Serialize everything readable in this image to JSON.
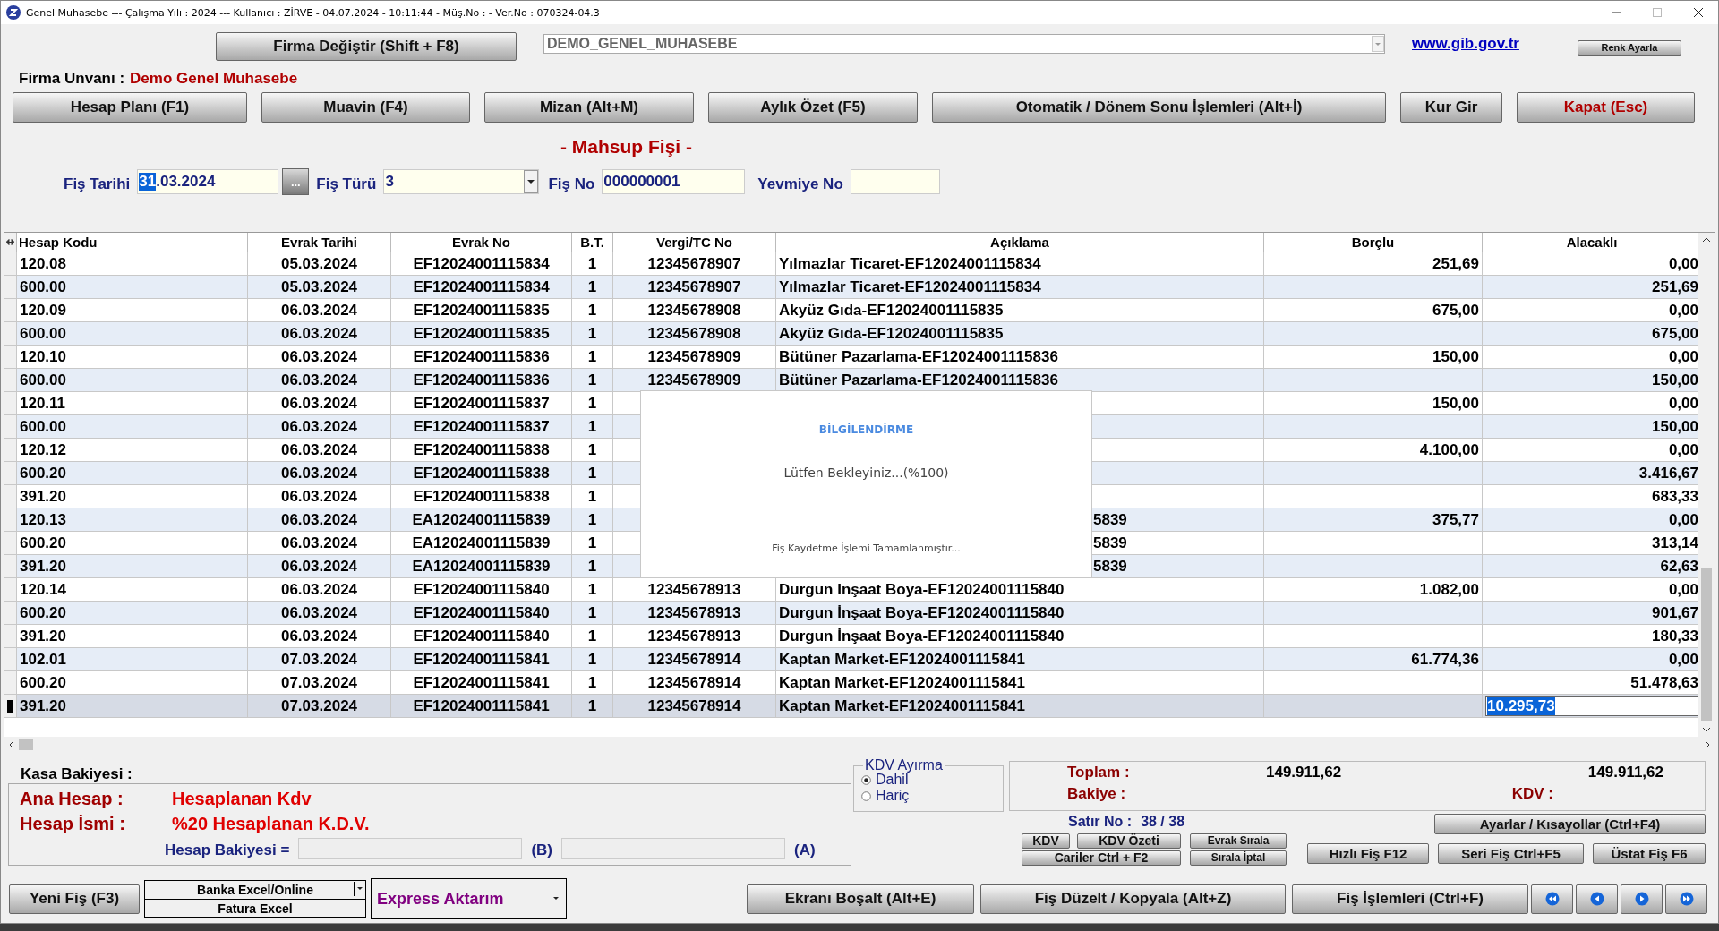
{
  "window": {
    "title": "Genel Muhasebe --- Çalışma Yılı : 2024 --- Kullanıcı : ZİRVE - 04.07.2024 - 10:11:44 - Müş.No : - Ver.No : 070324-04.3"
  },
  "toolbar": {
    "change_company_button": "Firma Değiştir (Shift + F8)",
    "database": "DEMO_GENEL_MUHASEBE",
    "link": "www.gib.gov.tr",
    "color_button": "Renk Ayarla"
  },
  "company": {
    "label": "Firma Unvanı :",
    "name": "Demo Genel Muhasebe"
  },
  "menu_buttons": [
    {
      "label": "Hesap Planı (F1)",
      "kind": "normal"
    },
    {
      "label": "Muavin (F4)",
      "kind": "normal"
    },
    {
      "label": "Mizan (Alt+M)",
      "kind": "normal"
    },
    {
      "label": "Aylık Özet (F5)",
      "kind": "normal"
    },
    {
      "label": "Otomatik / Dönem Sonu İşlemleri (Alt+İ)",
      "kind": "normal"
    },
    {
      "label": "Kur Gir",
      "kind": "normal"
    },
    {
      "label": "Kapat (Esc)",
      "kind": "danger"
    }
  ],
  "form": {
    "title": "- Mahsup Fişi -",
    "fields": [
      {
        "label": "Fiş Tarihi",
        "kind": "date",
        "button": "...",
        "value_parts": [
          {
            "text": "31",
            "selected": true
          },
          {
            "text": ".03.2024",
            "selected": false
          }
        ]
      },
      {
        "label": "Fiş Türü",
        "kind": "combo",
        "value_parts": [
          {
            "text": "3",
            "selected": false
          }
        ]
      },
      {
        "label": "Fiş No",
        "kind": "text",
        "value_parts": [
          {
            "text": "000000001",
            "selected": false
          }
        ]
      },
      {
        "label": "Yevmiye No",
        "kind": "short"
      }
    ]
  },
  "table": {
    "columns": [
      "Hesap Kodu",
      "Evrak Tarihi",
      "Evrak No",
      "B.T.",
      "Vergi/TC No",
      "Açıklama",
      "Borçlu",
      "Alacaklı"
    ],
    "rows": [
      {
        "hesap_kodu": "120.08",
        "evrak_tarihi": "05.03.2024",
        "evrak_no": "EF12024001115834",
        "bt": "1",
        "vergi": "12345678907",
        "aciklama": "Yılmazlar Ticaret-EF12024001115834",
        "borclu": "251,69",
        "alacakli": "0,00",
        "selected": false
      },
      {
        "hesap_kodu": "600.00",
        "evrak_tarihi": "05.03.2024",
        "evrak_no": "EF12024001115834",
        "bt": "1",
        "vergi": "12345678907",
        "aciklama": "Yılmazlar Ticaret-EF12024001115834",
        "alacakli": "251,69",
        "selected": false
      },
      {
        "hesap_kodu": "120.09",
        "evrak_tarihi": "06.03.2024",
        "evrak_no": "EF12024001115835",
        "bt": "1",
        "vergi": "12345678908",
        "aciklama": "Akyüz Gıda-EF12024001115835",
        "borclu": "675,00",
        "alacakli": "0,00",
        "selected": false
      },
      {
        "hesap_kodu": "600.00",
        "evrak_tarihi": "06.03.2024",
        "evrak_no": "EF12024001115835",
        "bt": "1",
        "vergi": "12345678908",
        "aciklama": "Akyüz Gıda-EF12024001115835",
        "alacakli": "675,00",
        "selected": false
      },
      {
        "hesap_kodu": "120.10",
        "evrak_tarihi": "06.03.2024",
        "evrak_no": "EF12024001115836",
        "bt": "1",
        "vergi": "12345678909",
        "aciklama": "Bütüner Pazarlama-EF12024001115836",
        "borclu": "150,00",
        "alacakli": "0,00",
        "selected": false
      },
      {
        "hesap_kodu": "600.00",
        "evrak_tarihi": "06.03.2024",
        "evrak_no": "EF12024001115836",
        "bt": "1",
        "vergi": "12345678909",
        "aciklama": "Bütüner Pazarlama-EF12024001115836",
        "alacakli": "150,00",
        "selected": false
      },
      {
        "hesap_kodu": "120.11",
        "evrak_tarihi": "06.03.2024",
        "evrak_no": "EF12024001115837",
        "bt": "1",
        "borclu": "150,00",
        "alacakli": "0,00",
        "selected": false
      },
      {
        "hesap_kodu": "600.00",
        "evrak_tarihi": "06.03.2024",
        "evrak_no": "EF12024001115837",
        "bt": "1",
        "alacakli": "150,00",
        "selected": false
      },
      {
        "hesap_kodu": "120.12",
        "evrak_tarihi": "06.03.2024",
        "evrak_no": "EF12024001115838",
        "bt": "1",
        "borclu": "4.100,00",
        "alacakli": "0,00",
        "selected": false
      },
      {
        "hesap_kodu": "600.20",
        "evrak_tarihi": "06.03.2024",
        "evrak_no": "EF12024001115838",
        "bt": "1",
        "alacakli": "3.416,67",
        "selected": false
      },
      {
        "hesap_kodu": "391.20",
        "evrak_tarihi": "06.03.2024",
        "evrak_no": "EF12024001115838",
        "bt": "1",
        "alacakli": "683,33",
        "selected": false
      },
      {
        "hesap_kodu": "120.13",
        "evrak_tarihi": "06.03.2024",
        "evrak_no": "EA12024001115839",
        "bt": "1",
        "aciklama_tail": "5839",
        "borclu": "375,77",
        "alacakli": "0,00",
        "selected": false
      },
      {
        "hesap_kodu": "600.20",
        "evrak_tarihi": "06.03.2024",
        "evrak_no": "EA12024001115839",
        "bt": "1",
        "aciklama_tail": "5839",
        "alacakli": "313,14",
        "selected": false
      },
      {
        "hesap_kodu": "391.20",
        "evrak_tarihi": "06.03.2024",
        "evrak_no": "EA12024001115839",
        "bt": "1",
        "aciklama_tail": "5839",
        "alacakli": "62,63",
        "selected": false
      },
      {
        "hesap_kodu": "120.14",
        "evrak_tarihi": "06.03.2024",
        "evrak_no": "EF12024001115840",
        "bt": "1",
        "vergi": "12345678913",
        "aciklama": "Durgun Inşaat Boya-EF12024001115840",
        "borclu": "1.082,00",
        "alacakli": "0,00",
        "selected": false
      },
      {
        "hesap_kodu": "600.20",
        "evrak_tarihi": "06.03.2024",
        "evrak_no": "EF12024001115840",
        "bt": "1",
        "vergi": "12345678913",
        "aciklama": "Durgun İnşaat Boya-EF12024001115840",
        "alacakli": "901,67",
        "selected": false
      },
      {
        "hesap_kodu": "391.20",
        "evrak_tarihi": "06.03.2024",
        "evrak_no": "EF12024001115840",
        "bt": "1",
        "vergi": "12345678913",
        "aciklama": "Durgun İnşaat Boya-EF12024001115840",
        "alacakli": "180,33",
        "selected": false
      },
      {
        "hesap_kodu": "102.01",
        "evrak_tarihi": "07.03.2024",
        "evrak_no": "EF12024001115841",
        "bt": "1",
        "vergi": "12345678914",
        "aciklama": "Kaptan Market-EF12024001115841",
        "borclu": "61.774,36",
        "alacakli": "0,00",
        "selected": false
      },
      {
        "hesap_kodu": "600.20",
        "evrak_tarihi": "07.03.2024",
        "evrak_no": "EF12024001115841",
        "bt": "1",
        "vergi": "12345678914",
        "aciklama": "Kaptan Market-EF12024001115841",
        "alacakli": "51.478,63",
        "selected": false
      },
      {
        "hesap_kodu": "391.20",
        "evrak_tarihi": "07.03.2024",
        "evrak_no": "EF12024001115841",
        "bt": "1",
        "vergi": "12345678914",
        "aciklama": "Kaptan Market-EF12024001115841",
        "alacakli": "10.295,73",
        "selected": true,
        "editing": true
      }
    ]
  },
  "dialog": {
    "title": "BİLGİLENDİRME",
    "message": "Lütfen Bekleyiniz...(%100)",
    "detail": "Fiş Kaydetme İşlemi Tamamlanmıştır..."
  },
  "account": {
    "kasa_label": "Kasa Bakiyesi :",
    "ana_hesap_label": "Ana Hesap :",
    "ana_hesap": "Hesaplanan Kdv",
    "hesap_ismi_label": "Hesap İsmi :",
    "hesap_ismi": "%20 Hesaplanan K.D.V.",
    "bakiye_label": "Hesap Bakiyesi =",
    "b_label": "(B)",
    "a_label": "(A)"
  },
  "kdv_group": {
    "title": "KDV Ayırma",
    "options": [
      {
        "label": "Dahil",
        "selected": true
      },
      {
        "label": "Hariç",
        "selected": false
      }
    ]
  },
  "totals": {
    "toplam_label": "Toplam :",
    "toplam_borclu": "149.911,62",
    "toplam_alacakli": "149.911,62",
    "bakiye_label": "Bakiye :",
    "kdv_label": "KDV :"
  },
  "row_counter": {
    "label": "Satır No :",
    "value": "38 / 38"
  },
  "small_buttons": [
    "KDV",
    "KDV Özeti",
    "Evrak Sırala",
    "Cariler Ctrl + F2",
    "Sırala İptal"
  ],
  "settings_button": "Ayarlar / Kısayollar (Ctrl+F4)",
  "side_buttons": [
    "Hızlı Fiş F12",
    "Seri Fiş Ctrl+F5",
    "Üstat Fiş F6"
  ],
  "footer": {
    "new_button": "Yeni Fiş (F3)",
    "import_options": [
      "Banka Excel/Online",
      "Fatura Excel"
    ],
    "express_combo": "Express Aktarım",
    "buttons": [
      "Ekranı Boşalt (Alt+E)",
      "Fiş Düzelt / Kopyala (Alt+Z)",
      "Fiş İşlemleri (Ctrl+F)"
    ]
  }
}
